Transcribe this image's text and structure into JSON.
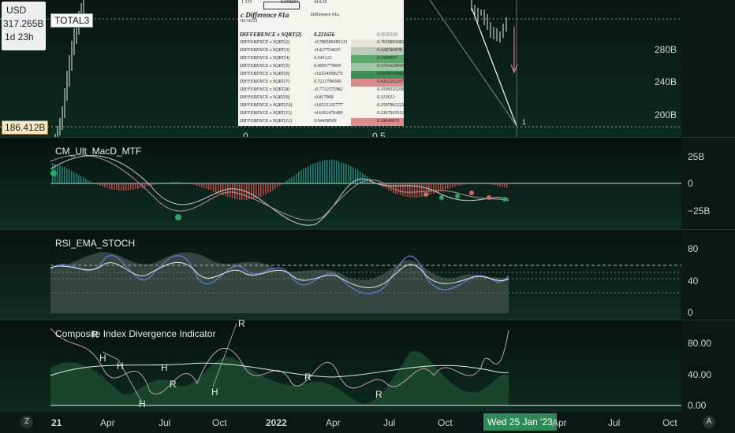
{
  "header": {
    "currency": "USD",
    "symbol": "TOTAL3",
    "last_price": "317.265B",
    "countdown": "1d 23h",
    "current_badge": "186.412B"
  },
  "price_axis": {
    "ticks": [
      "280B",
      "240B",
      "200B"
    ]
  },
  "price_pane": {
    "left_tick": "0",
    "fib_0_5": "0.5",
    "fib_1": "1"
  },
  "table": {
    "top_left": "1.135",
    "top_mid": "0.058294",
    "top_right": "414.35",
    "title": "c Difference #1a",
    "subtitle": "Difference #1a",
    "date": "01/16/23",
    "header_row": {
      "label": "DIFFERENCE x SQRT(2)",
      "v1": "0.221656",
      "v2": "0.858340"
    },
    "rows": [
      {
        "label": "DIFFERENCE x SQRT(2)",
        "v1": "-0.786589385131",
        "v2": "0.765989398291",
        "color": "#e8e6dc"
      },
      {
        "label": "DIFFERENCE x SQRT(3)",
        "v1": "-0.427754635",
        "v2": "0.428740978",
        "color": "#bfc8bf"
      },
      {
        "label": "DIFFERENCE x SQRT(4)",
        "v1": "0.545122",
        "v2": "0.3989897",
        "color": "#5aa86a"
      },
      {
        "label": "DIFFERENCE x SQRT(5)",
        "v1": "0.0095779605",
        "v2": "0.1741629645",
        "color": "#9fc7a5"
      },
      {
        "label": "DIFFERENCE x SQRT(6)",
        "v1": "-0.6524958273",
        "v2": "0.6078230982",
        "color": "#3f8e55"
      },
      {
        "label": "DIFFERENCE x SQRT(7)",
        "v1": "0.7213796580",
        "v2": "0.4362202307",
        "color": "#d98c8c"
      },
      {
        "label": "DIFFERENCE x SQRT(8)",
        "v1": "-0.7712575982",
        "v2": "0.3599535209",
        "color": "#f3f2ec"
      },
      {
        "label": "DIFFERENCE x SQRT(9)",
        "v1": "-0.817968",
        "v2": "0.313612",
        "color": "#f3f2ec"
      },
      {
        "label": "DIFFERENCE x SQRT(10)",
        "v1": "-0.6521235777",
        "v2": "0.2597862223",
        "color": "#f3f2ec"
      },
      {
        "label": "DIFFERENCE x SQRT(11)",
        "v1": "-0.6362476480",
        "v2": "0.2367303512",
        "color": "#f3f2ec"
      },
      {
        "label": "DIFFERENCE x SQRT(12)",
        "v1": "0.94458509",
        "v2": "0.18646871",
        "color": "#dd8b8b"
      }
    ]
  },
  "macd": {
    "title": "CM_Ult_MacD_MTF",
    "ticks": [
      "25B",
      "0",
      "−25B"
    ]
  },
  "rsi": {
    "title": "RSI_EMA_STOCH",
    "ticks": [
      "80",
      "40",
      "0"
    ]
  },
  "cdi": {
    "title": "Composite Index Divergence Indicator",
    "ticks": [
      "80.00",
      "40.00",
      "0.00"
    ],
    "marker_h": "H",
    "marker_r": "R"
  },
  "time_axis": {
    "labels": [
      "21",
      "Apr",
      "Jul",
      "Oct",
      "2022",
      "Apr",
      "Jul",
      "Oct",
      "Apr",
      "Jul",
      "Oct"
    ],
    "cursor_date": "Wed 25 Jan '23",
    "btn_z": "Z",
    "btn_a": "A"
  },
  "colors": {
    "bull": "#26a69a",
    "bear": "#ef5350",
    "accent": "#1b8a55",
    "bg": "#0b1714"
  }
}
